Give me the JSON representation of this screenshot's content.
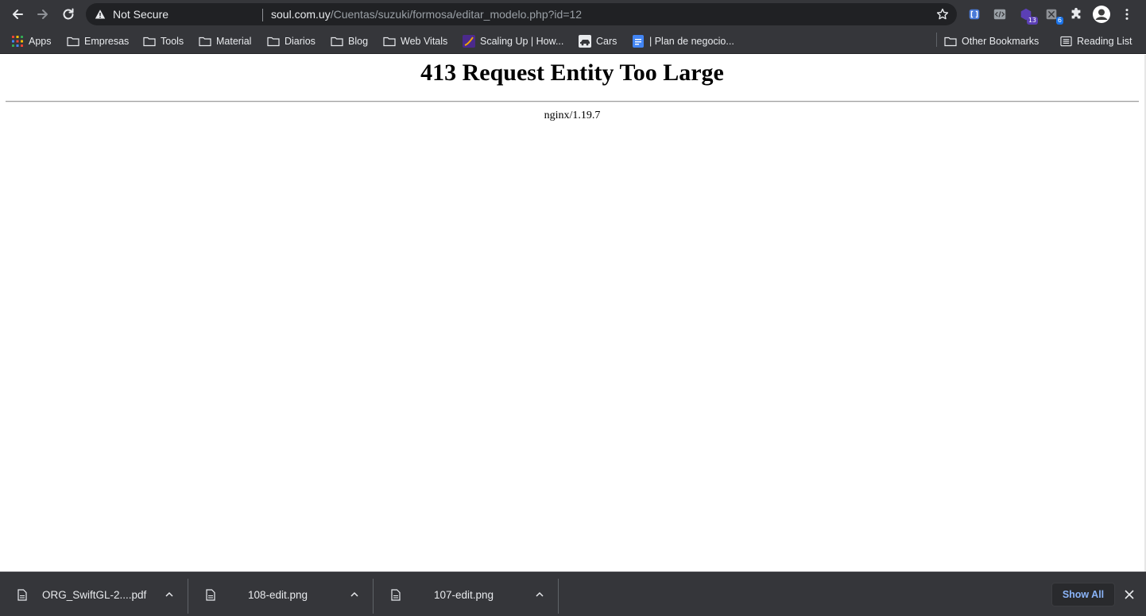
{
  "toolbar": {
    "security_label": "Not Secure",
    "url_host": "soul.com.uy",
    "url_path": "/Cuentas/suzuki/formosa/editar_modelo.php?id=12",
    "extensions": [
      {
        "icon": "bracket-extension-icon",
        "badge": ""
      },
      {
        "icon": "code-extension-icon",
        "badge": ""
      },
      {
        "icon": "purple-extension-icon",
        "badge": "13"
      },
      {
        "icon": "tools-extension-icon",
        "badge": "6"
      },
      {
        "icon": "puzzle-icon",
        "badge": ""
      }
    ],
    "colors": {
      "frame": "#35363a",
      "omnibox": "#202124",
      "text": "#e8eaed",
      "path": "#9aa0a6"
    }
  },
  "bookmarks": {
    "items": [
      {
        "label": "Apps",
        "icon": "apps-grid-icon"
      },
      {
        "label": "Empresas",
        "icon": "folder-icon"
      },
      {
        "label": "Tools",
        "icon": "folder-icon"
      },
      {
        "label": "Material",
        "icon": "folder-icon"
      },
      {
        "label": "Diarios",
        "icon": "folder-icon"
      },
      {
        "label": "Blog",
        "icon": "folder-icon"
      },
      {
        "label": "Web Vitals",
        "icon": "folder-icon"
      },
      {
        "label": "Scaling Up | How...",
        "icon": "scaling-up-favicon"
      },
      {
        "label": "Cars",
        "icon": "cars-favicon"
      },
      {
        "label": "| Plan de negocio...",
        "icon": "docs-favicon"
      }
    ],
    "other_bookmarks": "Other Bookmarks",
    "reading_list": "Reading List"
  },
  "page": {
    "heading": "413 Request Entity Too Large",
    "server": "nginx/1.19.7"
  },
  "downloads": {
    "items": [
      {
        "name": "ORG_SwiftGL-2....pdf"
      },
      {
        "name": "108-edit.png"
      },
      {
        "name": "107-edit.png"
      }
    ],
    "show_all": "Show All"
  }
}
